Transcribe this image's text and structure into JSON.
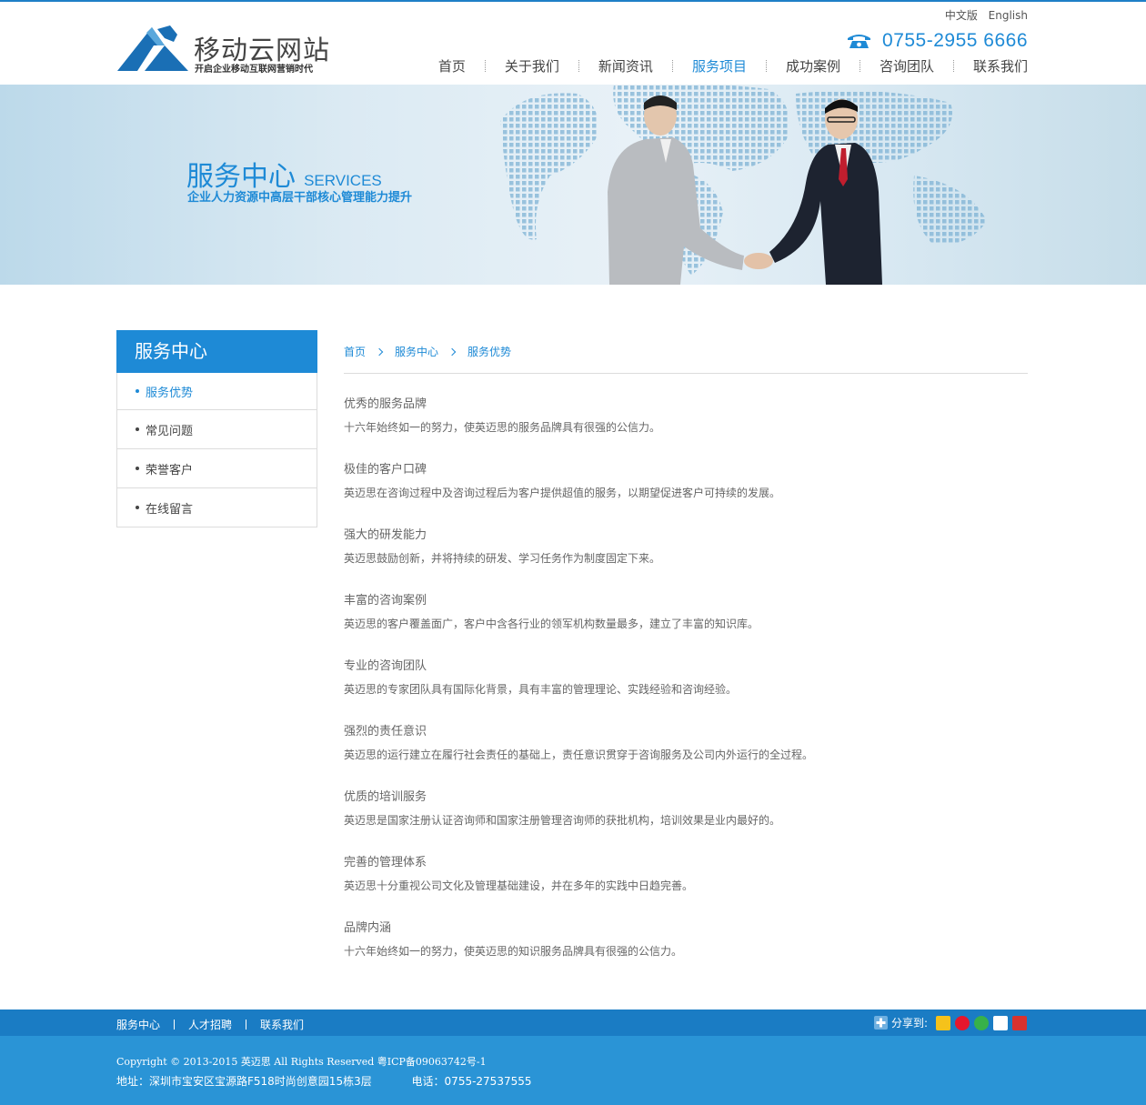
{
  "header": {
    "logo_name": "移动云网站",
    "logo_slogan": "开启企业移动互联网营销时代",
    "lang": [
      "中文版",
      "English"
    ],
    "phone": "0755-2955 6666",
    "nav": [
      "首页",
      "关于我们",
      "新闻资讯",
      "服务项目",
      "成功案例",
      "咨询团队",
      "联系我们"
    ],
    "nav_active": "服务项目"
  },
  "banner": {
    "title_cn": "服务中心",
    "title_en": "SERVICES",
    "subtitle": "企业人力资源中高层干部核心管理能力提升"
  },
  "sidebar": {
    "title": "服务中心",
    "items": [
      "服务优势",
      "常见问题",
      "荣誉客户",
      "在线留言"
    ],
    "active": "服务优势"
  },
  "breadcrumb": [
    "首页",
    "服务中心",
    "服务优势"
  ],
  "sections": [
    {
      "title": "优秀的服务品牌",
      "body": "十六年始终如一的努力，使英迈思的服务品牌具有很强的公信力。"
    },
    {
      "title": "极佳的客户口碑",
      "body": "英迈思在咨询过程中及咨询过程后为客户提供超值的服务，以期望促进客户可持续的发展。"
    },
    {
      "title": "强大的研发能力",
      "body": "英迈思鼓励创新，并将持续的研发、学习任务作为制度固定下来。"
    },
    {
      "title": "丰富的咨询案例",
      "body": "英迈思的客户覆盖面广，客户中含各行业的领军机构数量最多，建立了丰富的知识库。"
    },
    {
      "title": "专业的咨询团队",
      "body": "英迈思的专家团队具有国际化背景，具有丰富的管理理论、实践经验和咨询经验。"
    },
    {
      "title": "强烈的责任意识",
      "body": "英迈思的运行建立在履行社会责任的基础上，责任意识贯穿于咨询服务及公司内外运行的全过程。"
    },
    {
      "title": "优质的培训服务",
      "body": "英迈思是国家注册认证咨询师和国家注册管理咨询师的获批机构，培训效果是业内最好的。"
    },
    {
      "title": "完善的管理体系",
      "body": "英迈思十分重视公司文化及管理基础建设，并在多年的实践中日趋完善。"
    },
    {
      "title": "品牌内涵",
      "body": "十六年始终如一的努力，使英迈思的知识服务品牌具有很强的公信力。"
    }
  ],
  "footer": {
    "links": [
      "服务中心",
      "人才招聘",
      "联系我们"
    ],
    "share_label": "分享到:",
    "share_icons": [
      "qzone-icon",
      "weibo-icon",
      "tencent-weibo-icon",
      "renren-icon",
      "kaixin-icon"
    ],
    "copyright": "Copyright © 2013-2015 英迈思 All Rights Reserved 粤ICP备09063742号-1",
    "address": "地址：深圳市宝安区宝源路F518时尚创意园15栋3层",
    "tel": "电话：0755-27537555"
  },
  "colors": {
    "accent": "#1e8ad6",
    "footer_nav": "#1a7cc4",
    "footer": "#2a94d6"
  }
}
